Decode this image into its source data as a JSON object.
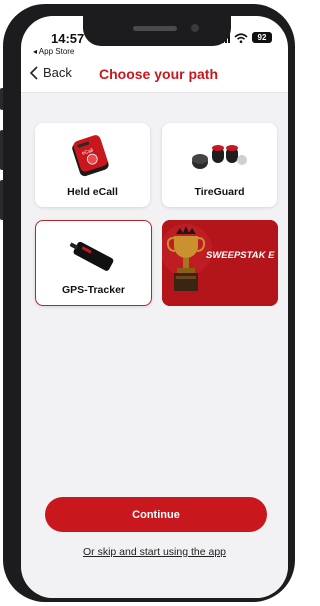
{
  "status_bar": {
    "time": "14:57",
    "back_app": "◂ App Store",
    "battery": "92",
    "icons": [
      "signal-icon",
      "wifi-icon",
      "battery-icon"
    ]
  },
  "header": {
    "back_label": "Back",
    "title": "Choose your path"
  },
  "options": [
    {
      "label": "Held eCall",
      "icon": "ecall-device-image",
      "selected": false
    },
    {
      "label": "TireGuard",
      "icon": "tire-sensor-image",
      "selected": false
    },
    {
      "label": "GPS-Tracker",
      "icon": "gps-tracker-image",
      "selected": true
    }
  ],
  "sweepstake": {
    "text": "SWEEPSTAK E",
    "icon": "trophy-image"
  },
  "continue_label": "Continue",
  "skip_label": "Or skip and start using the app",
  "colors": {
    "brand_red": "#c8181e",
    "selected_border": "#b3282d",
    "background": "#f2f2f4"
  }
}
